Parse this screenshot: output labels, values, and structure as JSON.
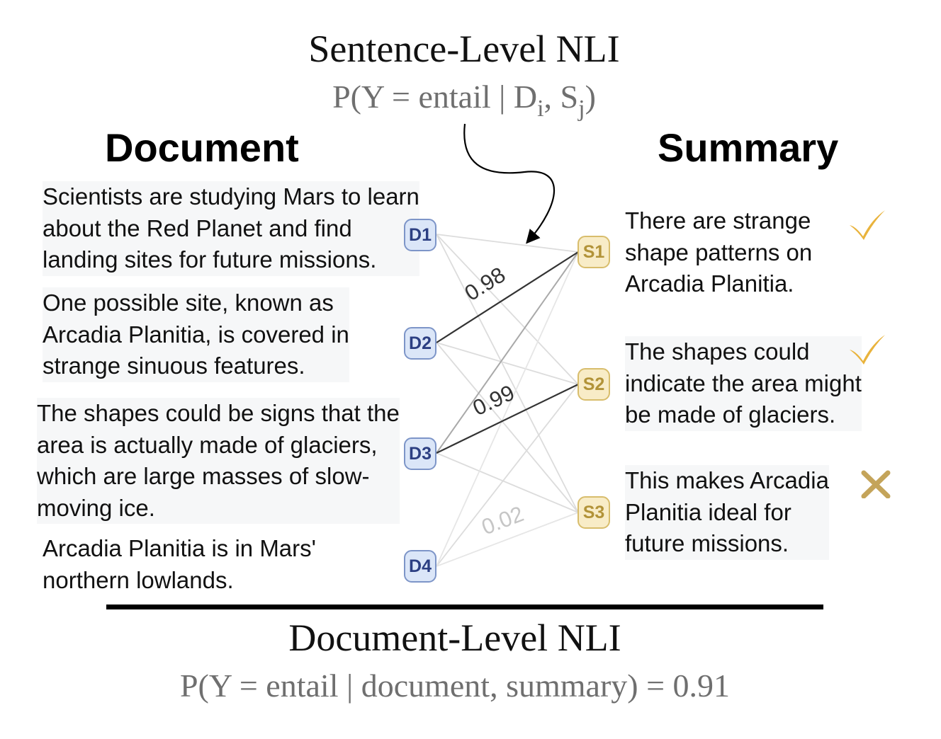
{
  "header": {
    "title": "Sentence-Level NLI",
    "formula_prefix": "P(Y = entail | D",
    "formula_sub_i": "i",
    "formula_mid": ", S",
    "formula_sub_j": "j",
    "formula_suffix": ")"
  },
  "document": {
    "heading": "Document",
    "sentences": [
      {
        "id": "D1",
        "lines": [
          "Scientists are studying Mars to learn",
          "about the Red Planet and find",
          "landing sites for future missions."
        ]
      },
      {
        "id": "D2",
        "lines": [
          "One possible site, known as",
          "Arcadia Planitia, is covered in",
          "strange sinuous features."
        ]
      },
      {
        "id": "D3",
        "lines": [
          "The shapes could be signs that the",
          "area is actually made of glaciers,",
          "which are large masses of slow-",
          "moving ice."
        ]
      },
      {
        "id": "D4",
        "lines": [
          "Arcadia Planitia is in Mars'",
          "northern lowlands."
        ]
      }
    ]
  },
  "summary": {
    "heading": "Summary",
    "sentences": [
      {
        "id": "S1",
        "lines": [
          "There are strange",
          "shape patterns on",
          "Arcadia Planitia."
        ],
        "verdict": "check-icon"
      },
      {
        "id": "S2",
        "lines": [
          "The shapes could",
          "indicate the area might",
          "be made of glaciers."
        ],
        "verdict": "check-icon"
      },
      {
        "id": "S3",
        "lines": [
          "This makes Arcadia",
          "Planitia ideal for",
          "future missions."
        ],
        "verdict": "cross-icon"
      }
    ]
  },
  "edges": {
    "labels": {
      "d2_s1": "0.98",
      "d3_s2": "0.99",
      "d4_s3": "0.02"
    }
  },
  "footer": {
    "title": "Document-Level NLI",
    "formula": "P(Y = entail | document, summary) = 0.91"
  },
  "colors": {
    "doc_node_fill": "#dbe6f8",
    "doc_node_border": "#7d95c8",
    "doc_node_text": "#2c3f82",
    "sum_node_fill": "#f8ecc7",
    "sum_node_border": "#d8bd6c",
    "sum_node_text": "#b29338",
    "check": "#e9b33c",
    "cross": "#c4a45a",
    "formula_gray": "#6f6f6f"
  }
}
